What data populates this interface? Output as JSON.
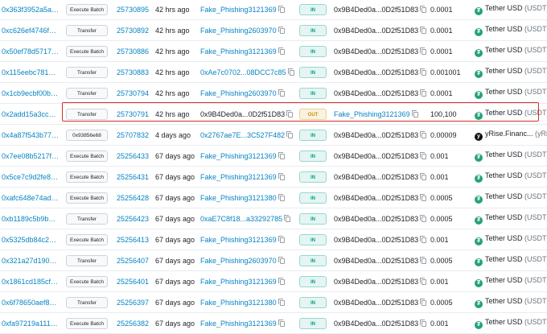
{
  "transfers": [
    {
      "hash": "0x363f3952a5a…",
      "method": "Execute Batch",
      "block": "25730895",
      "age": "42 hrs ago",
      "from": "Fake_Phishing3121369",
      "direction": "IN",
      "to": "0x9B4Ded0a...0D2f51D83",
      "amount": "0.0001",
      "token": "Tether USD",
      "token_symbol": "(USDT)",
      "token_icon": "tether-icon"
    },
    {
      "hash": "0xc626ef4746f…",
      "method": "Transfer",
      "block": "25730892",
      "age": "42 hrs ago",
      "from": "Fake_Phishing2603970",
      "direction": "IN",
      "to": "0x9B4Ded0a...0D2f51D83",
      "amount": "0.0001",
      "token": "Tether USD",
      "token_symbol": "(USDT)",
      "token_icon": "tether-icon"
    },
    {
      "hash": "0x50ef78d5717…",
      "method": "Execute Batch",
      "block": "25730886",
      "age": "42 hrs ago",
      "from": "Fake_Phishing3121369",
      "direction": "IN",
      "to": "0x9B4Ded0a...0D2f51D83",
      "amount": "0.0001",
      "token": "Tether USD",
      "token_symbol": "(USDT)",
      "token_icon": "tether-icon"
    },
    {
      "hash": "0x115eebc781…",
      "method": "Transfer",
      "block": "25730883",
      "age": "42 hrs ago",
      "from": "0xAe7c0702...08DCC7c85",
      "direction": "IN",
      "to": "0x9B4Ded0a...0D2f51D83",
      "amount": "0.001001",
      "token": "Tether USD",
      "token_symbol": "(USDT)",
      "token_icon": "tether-icon"
    },
    {
      "hash": "0x1cb9ecbf00b…",
      "method": "Transfer",
      "block": "25730794",
      "age": "42 hrs ago",
      "from": "Fake_Phishing2603970",
      "direction": "IN",
      "to": "0x9B4Ded0a...0D2f51D83",
      "amount": "0.0001",
      "token": "Tether USD",
      "token_symbol": "(USDT)",
      "token_icon": "tether-icon"
    },
    {
      "hash": "0x2add15a3cc…",
      "method": "Transfer",
      "block": "25730791",
      "age": "42 hrs ago",
      "from": "0x9B4Ded0a...0D2f51D83",
      "direction": "OUT",
      "to": "Fake_Phishing3121369",
      "amount": "100,100",
      "token": "Tether USD",
      "token_symbol": "(USDT)",
      "token_icon": "tether-icon"
    },
    {
      "hash": "0x4a87f543b77…",
      "method": "0x93856e68",
      "block": "25707832",
      "age": "4 days ago",
      "from": "0x2767ae7E...3C527F482",
      "direction": "IN",
      "to": "0x9B4Ded0a...0D2f51D83",
      "amount": "0.00009",
      "token": "yRise.Financ...",
      "token_symbol": "(yRise)",
      "token_icon": "yrise-icon"
    },
    {
      "hash": "0x7ee08b5217f…",
      "method": "Execute Batch",
      "block": "25256433",
      "age": "67 days ago",
      "from": "Fake_Phishing3121369",
      "direction": "IN",
      "to": "0x9B4Ded0a...0D2f51D83",
      "amount": "0.001",
      "token": "Tether USD",
      "token_symbol": "(USDT)",
      "token_icon": "tether-icon"
    },
    {
      "hash": "0x5ce7c9d2fe8…",
      "method": "Execute Batch",
      "block": "25256431",
      "age": "67 days ago",
      "from": "Fake_Phishing3121369",
      "direction": "IN",
      "to": "0x9B4Ded0a...0D2f51D83",
      "amount": "0.001",
      "token": "Tether USD",
      "token_symbol": "(USDT)",
      "token_icon": "tether-icon"
    },
    {
      "hash": "0xafc648e74ad…",
      "method": "Execute Batch",
      "block": "25256428",
      "age": "67 days ago",
      "from": "Fake_Phishing3121380",
      "direction": "IN",
      "to": "0x9B4Ded0a...0D2f51D83",
      "amount": "0.0005",
      "token": "Tether USD",
      "token_symbol": "(USDT)",
      "token_icon": "tether-icon"
    },
    {
      "hash": "0xb1189c5b9b…",
      "method": "Transfer",
      "block": "25256423",
      "age": "67 days ago",
      "from": "0xaE7C8f18...a33292785",
      "direction": "IN",
      "to": "0x9B4Ded0a...0D2f51D83",
      "amount": "0.0005",
      "token": "Tether USD",
      "token_symbol": "(USDT)",
      "token_icon": "tether-icon"
    },
    {
      "hash": "0x5325db84c2…",
      "method": "Execute Batch",
      "block": "25256413",
      "age": "67 days ago",
      "from": "Fake_Phishing3121369",
      "direction": "IN",
      "to": "0x9B4Ded0a...0D2f51D83",
      "amount": "0.001",
      "token": "Tether USD",
      "token_symbol": "(USDT)",
      "token_icon": "tether-icon"
    },
    {
      "hash": "0x321a27d190…",
      "method": "Transfer",
      "block": "25256407",
      "age": "67 days ago",
      "from": "Fake_Phishing2603970",
      "direction": "IN",
      "to": "0x9B4Ded0a...0D2f51D83",
      "amount": "0.0005",
      "token": "Tether USD",
      "token_symbol": "(USDT)",
      "token_icon": "tether-icon"
    },
    {
      "hash": "0x1861cd185cf…",
      "method": "Execute Batch",
      "block": "25256401",
      "age": "67 days ago",
      "from": "Fake_Phishing3121369",
      "direction": "IN",
      "to": "0x9B4Ded0a...0D2f51D83",
      "amount": "0.001",
      "token": "Tether USD",
      "token_symbol": "(USDT)",
      "token_icon": "tether-icon"
    },
    {
      "hash": "0x6f78650aef8…",
      "method": "Transfer",
      "block": "25256397",
      "age": "67 days ago",
      "from": "Fake_Phishing3121380",
      "direction": "IN",
      "to": "0x9B4Ded0a...0D2f51D83",
      "amount": "0.0005",
      "token": "Tether USD",
      "token_symbol": "(USDT)",
      "token_icon": "tether-icon"
    },
    {
      "hash": "0xfa97219a111…",
      "method": "Execute Batch",
      "block": "25256382",
      "age": "67 days ago",
      "from": "Fake_Phishing3121369",
      "direction": "IN",
      "to": "0x9B4Ded0a...0D2f51D83",
      "amount": "0.001",
      "token": "Tether USD",
      "token_symbol": "(USDT)",
      "token_icon": "tether-icon"
    }
  ],
  "colors": {
    "link": "#0784c3",
    "in_badge": "#00a186",
    "out_badge": "#c79100",
    "highlight": "#d9302a",
    "tether": "#26a17b"
  }
}
